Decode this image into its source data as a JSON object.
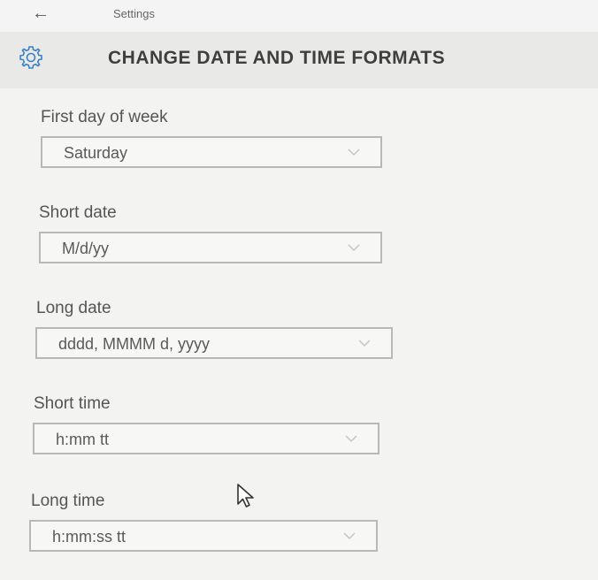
{
  "titlebar": {
    "back_glyph": "←",
    "app_title": "Settings"
  },
  "header": {
    "title": "CHANGE DATE AND TIME FORMATS",
    "icon": "gear-icon"
  },
  "fields": [
    {
      "label": "First day of week",
      "value": "Saturday"
    },
    {
      "label": "Short date",
      "value": "M/d/yy"
    },
    {
      "label": "Long date",
      "value": "dddd, MMMM d, yyyy"
    },
    {
      "label": "Short time",
      "value": "h:mm tt"
    },
    {
      "label": "Long time",
      "value": "h:mm:ss tt"
    }
  ],
  "icons": {
    "dropdown": "chevron-down-icon",
    "pointer": "mouse-cursor-icon"
  },
  "colors": {
    "background": "#f3f3f1",
    "border": "#b8b8b8",
    "text": "#555555"
  }
}
